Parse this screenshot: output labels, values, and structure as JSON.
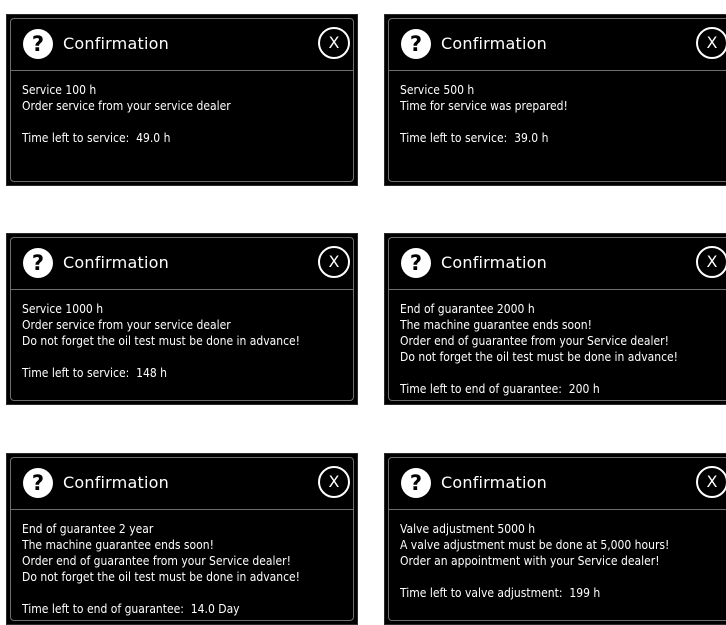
{
  "dialogs": [
    {
      "title": "Confirmation",
      "help_glyph": "?",
      "close_label": "X",
      "lines": [
        "Service 100 h",
        "Order service from your service dealer"
      ],
      "time_label": "Time left to service:",
      "time_value": "49.0 h"
    },
    {
      "title": "Confirmation",
      "help_glyph": "?",
      "close_label": "X",
      "lines": [
        "Service 500 h",
        "Time for service was prepared!"
      ],
      "time_label": "Time left to service:",
      "time_value": "39.0 h"
    },
    {
      "title": "Confirmation",
      "help_glyph": "?",
      "close_label": "X",
      "lines": [
        "Service 1000 h",
        "Order service from your service dealer",
        "Do not forget the oil test must be done in advance!"
      ],
      "time_label": "Time left to service:",
      "time_value": "148 h"
    },
    {
      "title": "Confirmation",
      "help_glyph": "?",
      "close_label": "X",
      "lines": [
        "End of guarantee 2000 h",
        "The machine guarantee ends soon!",
        "Order end of guarantee from your Service dealer!",
        "Do not forget the oil test must be done in advance!"
      ],
      "time_label": "Time left to end of guarantee:",
      "time_value": "200 h"
    },
    {
      "title": "Confirmation",
      "help_glyph": "?",
      "close_label": "X",
      "lines": [
        "End of guarantee 2 year",
        "The machine guarantee ends soon!",
        "Order end of guarantee from your Service dealer!",
        "Do not forget the oil test must be done in advance!"
      ],
      "time_label": "Time left to end of guarantee:",
      "time_value": "14.0 Day"
    },
    {
      "title": "Confirmation",
      "help_glyph": "?",
      "close_label": "X",
      "lines": [
        "Valve adjustment 5000 h",
        "A valve adjustment must be done at 5,000 hours!",
        "Order an appointment with your Service dealer!"
      ],
      "time_label": "Time left to valve adjustment:",
      "time_value": "199 h"
    }
  ],
  "colors": {
    "dialog_background": "#000000",
    "text": "#ffffff",
    "border": "#6e6e6e",
    "page_background": "#ffffff"
  }
}
